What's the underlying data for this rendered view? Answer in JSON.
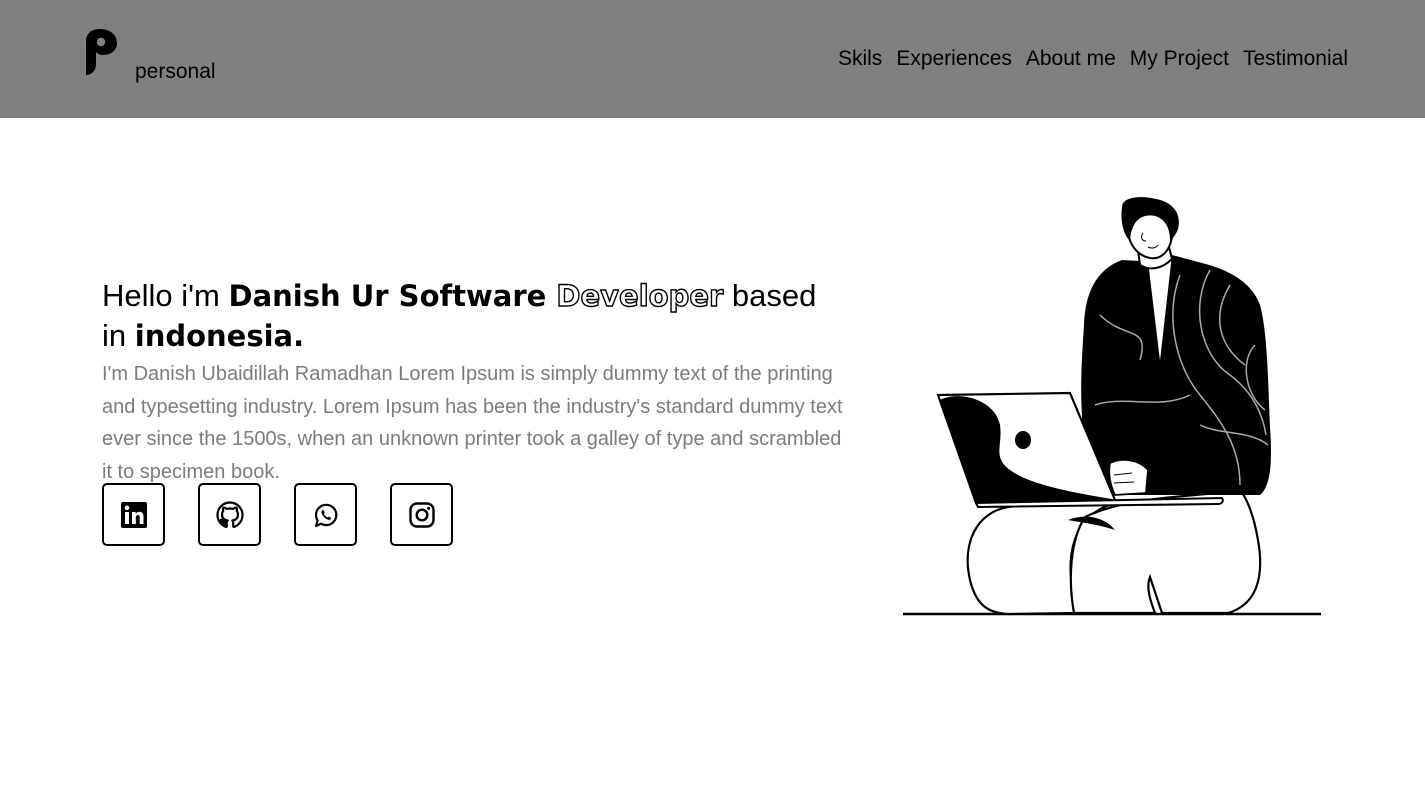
{
  "header": {
    "brand": "personal",
    "logo_icon": "p-logo-icon",
    "nav": [
      "Skils",
      "Experiences",
      "About me",
      "My Project",
      "Testimonial"
    ]
  },
  "hero": {
    "greeting": "Hello i'm ",
    "name": "Danish Ur Software ",
    "role_outlined": "Developer",
    "based": " based in ",
    "location": "indonesia.",
    "bio": "I'm Danish Ubaidillah Ramadhan Lorem Ipsum is simply dummy text of the printing and typesetting industry. Lorem Ipsum has been the industry's standard dummy text ever since the 1500s, when an unknown printer took a galley of type and scrambled it to specimen book."
  },
  "socials": [
    {
      "name": "linkedin",
      "icon": "linkedin-icon"
    },
    {
      "name": "github",
      "icon": "github-icon"
    },
    {
      "name": "whatsapp",
      "icon": "whatsapp-icon"
    },
    {
      "name": "instagram",
      "icon": "instagram-icon"
    }
  ],
  "illustration": {
    "icon": "person-with-laptop-illustration"
  },
  "colors": {
    "navbar_bg": "#808080",
    "body_bg": "#ffffff",
    "bio_text": "#7b7b82",
    "text": "#000000"
  }
}
